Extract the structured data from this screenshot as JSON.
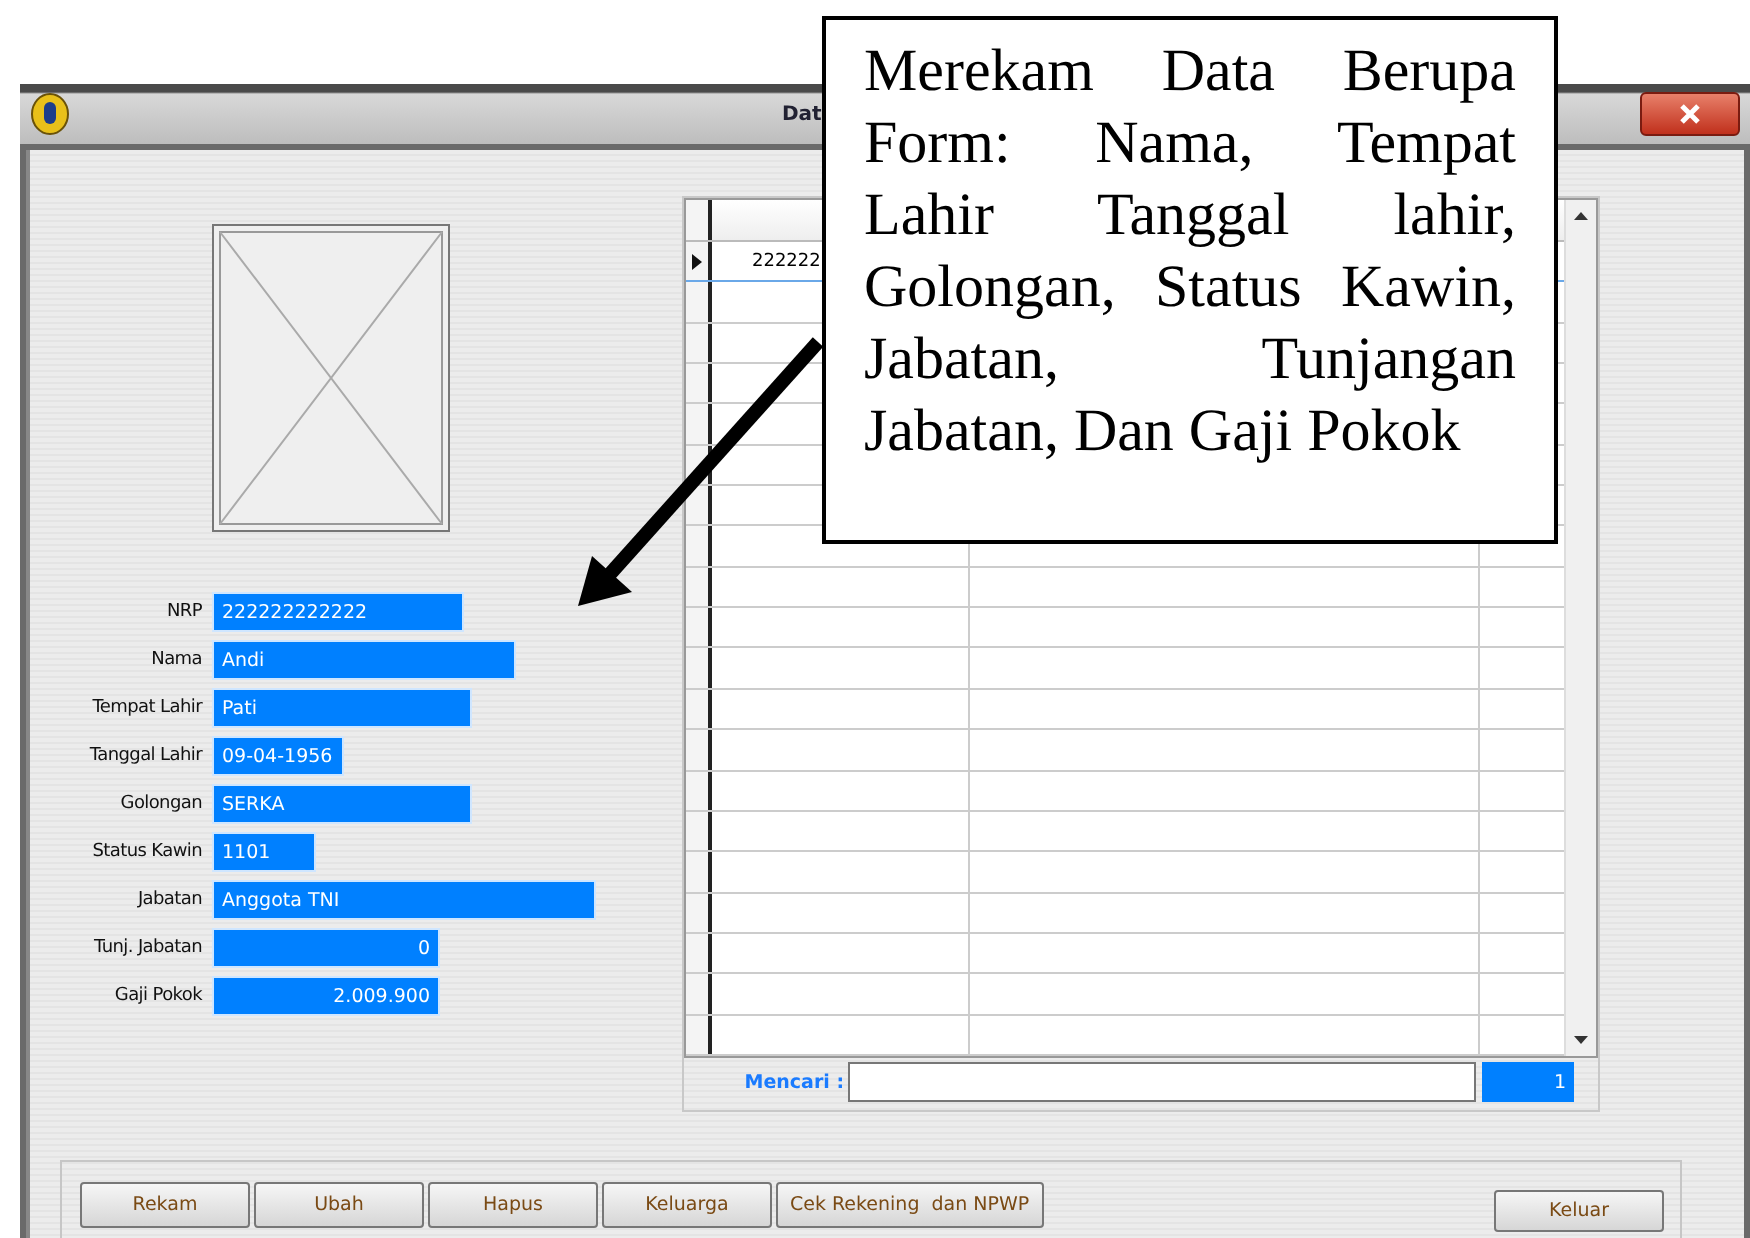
{
  "window": {
    "title": "Dat"
  },
  "callout": {
    "text": "Merekam Data Berupa Form: Nama, Tempat Lahir Tanggal lahir, Golongan, Status Kawin, Jabatan, Tunjangan Jabatan, Dan Gaji Pokok"
  },
  "form": {
    "fields": [
      {
        "label": "NRP",
        "value": "222222222222",
        "kind": "text"
      },
      {
        "label": "Nama",
        "value": "Andi",
        "kind": "text"
      },
      {
        "label": "Tempat Lahir",
        "value": "Pati",
        "kind": "text"
      },
      {
        "label": "Tanggal Lahir",
        "value": "09-04-1956",
        "kind": "text"
      },
      {
        "label": "Golongan",
        "value": "SERKA",
        "kind": "text"
      },
      {
        "label": "Status Kawin",
        "value": "1101",
        "kind": "text"
      },
      {
        "label": "Jabatan",
        "value": "Anggota TNI",
        "kind": "text"
      },
      {
        "label": "Tunj. Jabatan",
        "value": "0",
        "kind": "number"
      },
      {
        "label": "Gaji Pokok",
        "value": "2.009.900",
        "kind": "number"
      }
    ]
  },
  "grid": {
    "rows": [
      {
        "cell_1": "222222",
        "current": true
      }
    ]
  },
  "search": {
    "label": "Mencari :",
    "count": "1"
  },
  "buttons": [
    "Rekam",
    "Ubah",
    "Hapus",
    "Keluarga",
    "Cek Rekening  dan NPWP"
  ],
  "exit_button": "Keluar"
}
